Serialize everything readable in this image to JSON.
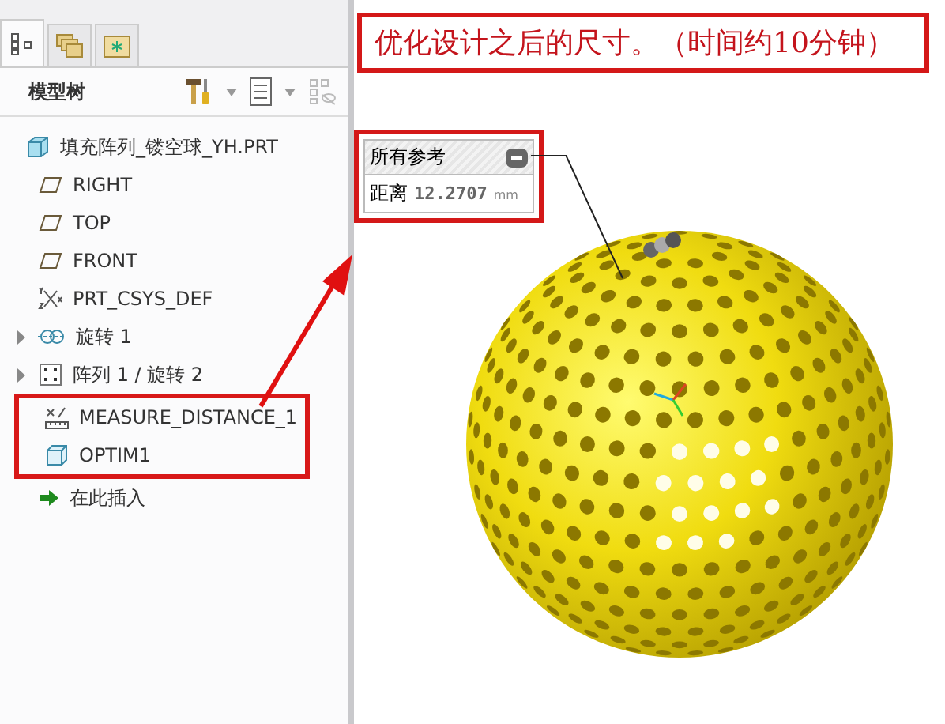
{
  "panel_tabs": [
    {
      "kind": "tree",
      "selected": true
    },
    {
      "kind": "folders",
      "selected": false
    },
    {
      "kind": "favorites",
      "selected": false
    }
  ],
  "tree_header": {
    "title": "模型树"
  },
  "tree": [
    {
      "label": "填充阵列_镂空球_YH.PRT",
      "kind": "part",
      "children": [
        {
          "label": "RIGHT",
          "kind": "plane",
          "highlighted": false
        },
        {
          "label": "TOP",
          "kind": "plane",
          "highlighted": false
        },
        {
          "label": "FRONT",
          "kind": "plane",
          "highlighted": false
        },
        {
          "label": "PRT_CSYS_DEF",
          "kind": "csys",
          "highlighted": false
        },
        {
          "label": "旋转 1",
          "kind": "revolve",
          "expanded": false,
          "highlighted": false
        },
        {
          "label": "阵列 1 / 旋转 2",
          "kind": "pattern",
          "expanded": false,
          "highlighted": false
        },
        {
          "label": "MEASURE_DISTANCE_1",
          "kind": "measure",
          "highlighted": true
        },
        {
          "label": "OPTIM1",
          "kind": "feature",
          "highlighted": true
        },
        {
          "label": "在此插入",
          "kind": "insert",
          "highlighted": false
        }
      ]
    }
  ],
  "annotation": {
    "text": "优化设计之后的尺寸。（时间约10分钟）"
  },
  "measure": {
    "title": "所有参考",
    "highlighted": true,
    "label": "距离",
    "value": "12.2707",
    "unit": "mm"
  }
}
